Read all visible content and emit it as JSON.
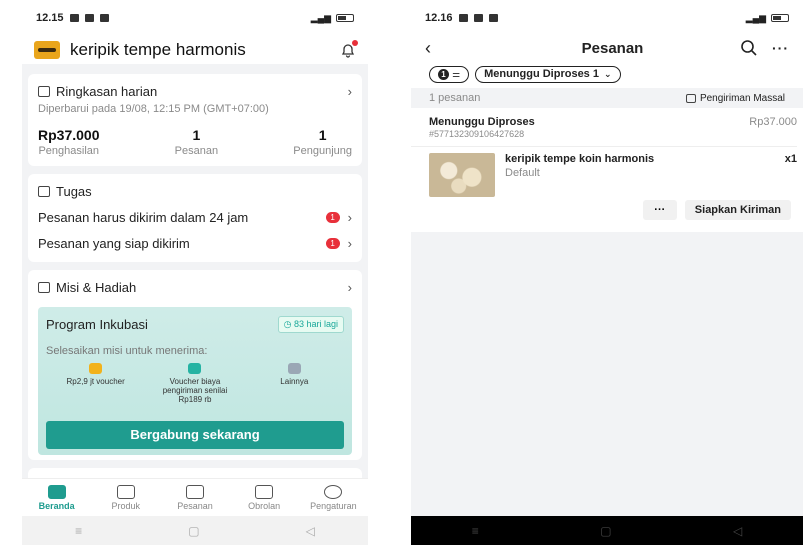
{
  "left": {
    "status": {
      "time": "12.15"
    },
    "header": {
      "shop_name": "keripik tempe harmonis"
    },
    "ringkasan": {
      "title": "Ringkasan harian",
      "updated": "Diperbarui pada 19/08, 12:15 PM (GMT+07:00)",
      "stats": [
        {
          "value": "Rp37.000",
          "label": "Penghasilan"
        },
        {
          "value": "1",
          "label": "Pesanan"
        },
        {
          "value": "1",
          "label": "Pengunjung"
        }
      ]
    },
    "tugas": {
      "title": "Tugas",
      "items": [
        {
          "text": "Pesanan harus dikirim dalam 24 jam",
          "badge": "1"
        },
        {
          "text": "Pesanan yang siap dikirim",
          "badge": "1"
        }
      ]
    },
    "misi": {
      "title": "Misi & Hadiah",
      "program_title": "Program Inkubasi",
      "days_left": "83 hari lagi",
      "subtitle": "Selesaikan misi untuk menerima:",
      "rewards": [
        {
          "label": "Rp2,9 jt voucher",
          "color": "#f2b21b"
        },
        {
          "label": "Voucher biaya pengiriman senilai Rp189 rb",
          "color": "#25b3a3"
        },
        {
          "label": "Lainnya",
          "color": "#9aa7b5"
        }
      ],
      "join_label": "Bergabung sekarang"
    },
    "tabs": [
      {
        "label": "Beranda",
        "icon": "home-icon"
      },
      {
        "label": "Produk",
        "icon": "bag-icon"
      },
      {
        "label": "Pesanan",
        "icon": "clipboard-icon"
      },
      {
        "label": "Obrolan",
        "icon": "chat-icon"
      },
      {
        "label": "Pengaturan",
        "icon": "gear-icon"
      }
    ],
    "accent": "#1f9c8f"
  },
  "right": {
    "status": {
      "time": "12.16"
    },
    "header": {
      "title": "Pesanan"
    },
    "filters": {
      "count": "1",
      "status_chip": "Menunggu Diproses 1"
    },
    "summary": {
      "count_label": "1 pesanan",
      "mass_label": "Pengiriman Massal"
    },
    "order": {
      "status": "Menunggu Diproses",
      "id": "#577132309106427628",
      "price": "Rp37.000",
      "item_name": "keripik tempe koin harmonis",
      "variant": "Default",
      "qty": "x1",
      "more_label": "···",
      "ship_label": "Siapkan Kiriman"
    }
  }
}
